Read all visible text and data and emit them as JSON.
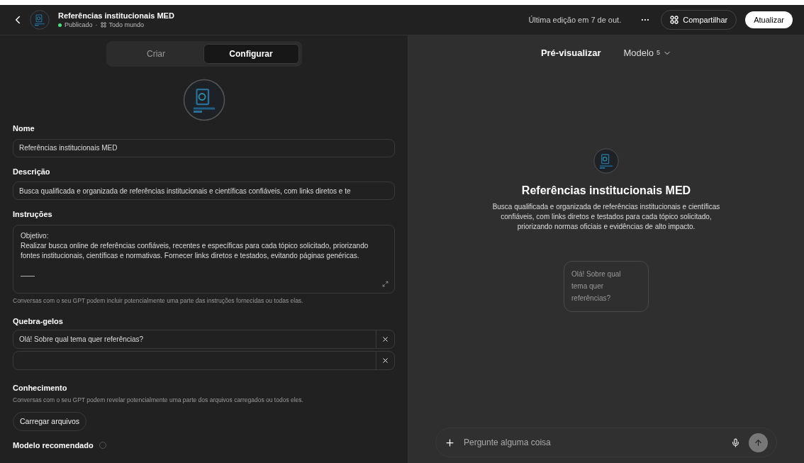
{
  "header": {
    "title": "Referências institucionais MED",
    "status": "Publicado",
    "separator": "·",
    "visibility": "Todo mundo",
    "last_edit": "Última edição em 7 de out.",
    "more": "···",
    "share": "Compartilhar",
    "update": "Atualizar"
  },
  "tabs": [
    {
      "label": "Criar",
      "selected": false
    },
    {
      "label": "Configurar",
      "selected": true
    }
  ],
  "form": {
    "name_label": "Nome",
    "name_value": "Referências institucionais MED",
    "description_label": "Descrição",
    "description_value": "Busca qualificada e organizada de referências institucionais e científicas confiáveis, com links diretos e te",
    "instructions_label": "Instruções",
    "instructions_lines": [
      "Objetivo:",
      "Realizar busca online de referências confiáveis, recentes e específicas para cada tópico solicitado, priorizando fontes institucionais, científicas e normativas. Fornecer links diretos e testados, evitando páginas genéricas."
    ],
    "instructions_divider": "——",
    "instructions_note": "Conversas com o seu GPT podem incluir potencialmente uma parte das instruções fornecidas ou todas elas.",
    "starters_label": "Quebra-gelos",
    "starters": [
      {
        "kind": "filled",
        "value": "Olá! Sobre qual tema quer referências?"
      },
      {
        "kind": "empty"
      }
    ],
    "knowledge_label": "Conhecimento",
    "knowledge_note": "Conversas com o seu GPT podem revelar potencialmente uma parte dos arquivos carregados ou todos eles.",
    "upload": "Carregar arquivos",
    "model_label": "Modelo recomendado"
  },
  "preview": {
    "title": "Pré-visualizar",
    "model": "Modelo",
    "model_version": "5",
    "gpt_name": "Referências institucionais MED",
    "gpt_description": "Busca qualificada e organizada de referências institucionais e científicas confiáveis, com links diretos e testados para cada tópico solicitado, priorizando normas oficiais e evidências de alto impacto.",
    "starter_card": "Olá! Sobre qual tema quer referências?",
    "composer_placeholder": "Pergunte alguma coisa"
  }
}
